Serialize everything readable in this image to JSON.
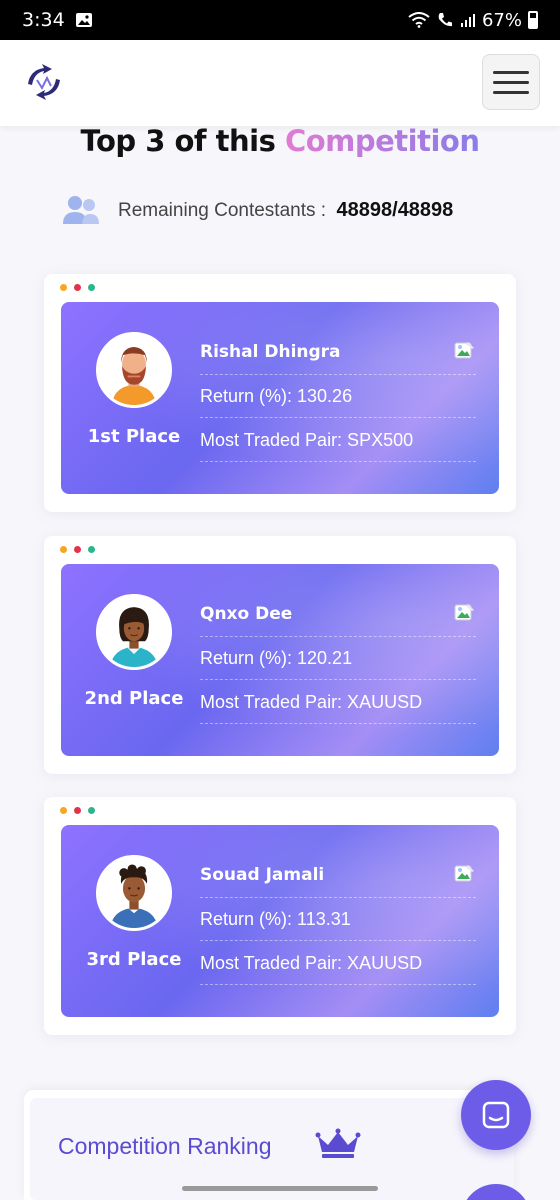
{
  "status_bar": {
    "time": "3:34",
    "battery": "67%"
  },
  "header": {
    "logo_icon": "brand-logo-arrows",
    "menu_icon": "hamburger-icon"
  },
  "title": {
    "prefix": "Top 3 of this ",
    "accent": "Competition"
  },
  "contestants": {
    "label": "Remaining Contestants :",
    "value": "48898/48898"
  },
  "winners": [
    {
      "place": "1st Place",
      "name": "Rishal Dhingra",
      "return_text": "Return (%): 130.26",
      "pair_text": "Most Traded Pair: SPX500",
      "avatar": "bearded-man-avatar"
    },
    {
      "place": "2nd Place",
      "name": "Qnxo Dee",
      "return_text": "Return (%): 120.21",
      "pair_text": "Most Traded Pair: XAUUSD",
      "avatar": "woman-avatar"
    },
    {
      "place": "3rd Place",
      "name": "Souad Jamali",
      "return_text": "Return (%): 113.31",
      "pair_text": "Most Traded Pair: XAUUSD",
      "avatar": "curly-hair-man-avatar"
    }
  ],
  "ranking": {
    "label": "Competition Ranking",
    "icon": "crown-icon"
  },
  "colors": {
    "accent": "#6c5ce7",
    "card_gradient_start": "#8e72ff",
    "card_gradient_end": "#5f7ff0"
  }
}
